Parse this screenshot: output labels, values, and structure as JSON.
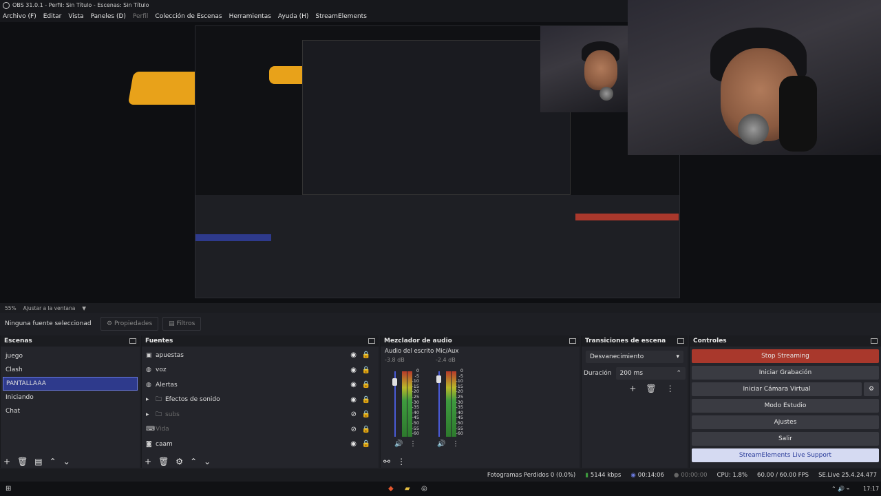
{
  "window": {
    "title": "OBS 31.0.1 - Perfil: Sin Título - Escenas: Sin Título"
  },
  "menu": [
    "Archivo (F)",
    "Editar",
    "Vista",
    "Paneles (D)",
    "Perfil",
    "Colección de Escenas",
    "Herramientas",
    "Ayuda (H)",
    "StreamElements"
  ],
  "preview_status": {
    "zoom": "55%",
    "fit": "Ajustar a la ventana"
  },
  "properties_bar": {
    "no_selection": "Ninguna fuente seleccionad",
    "properties": "Propiedades",
    "filters": "Filtros"
  },
  "scenes": {
    "title": "Escenas",
    "items": [
      "juego",
      "Clash",
      "PANTALLAAA",
      "Iniciando",
      "Chat"
    ],
    "selected": "PANTALLAAA"
  },
  "sources": {
    "title": "Fuentes",
    "items": [
      {
        "label": "apuestas",
        "icon": "monitor-icon",
        "visible": true
      },
      {
        "label": "voz",
        "icon": "globe-icon",
        "visible": true
      },
      {
        "label": "Alertas",
        "icon": "globe-icon",
        "visible": true
      },
      {
        "label": "Efectos de sonido",
        "icon": "folder-icon",
        "visible": true,
        "group": true
      },
      {
        "label": "subs",
        "icon": "folder-icon",
        "visible": false,
        "group": true
      },
      {
        "label": "Vida",
        "icon": "gamepad-icon",
        "visible": false
      },
      {
        "label": "caam",
        "icon": "camera-icon",
        "visible": true
      }
    ]
  },
  "mixer": {
    "title": "Mezclador de audio",
    "channels": [
      {
        "name": "Audio del escrito",
        "db": "-3.8 dB",
        "level": 0.75
      },
      {
        "name": "Mic/Aux",
        "db": "-2.4 dB",
        "level": 0.8
      }
    ],
    "scale": [
      "0",
      "-5",
      "-10",
      "-15",
      "-20",
      "-25",
      "-30",
      "-35",
      "-40",
      "-45",
      "-50",
      "-55",
      "-60"
    ]
  },
  "transitions": {
    "title": "Transiciones de escena",
    "selected": "Desvanecimiento",
    "duration_label": "Duración",
    "duration": "200 ms"
  },
  "controls": {
    "title": "Controles",
    "stop_streaming": "Stop Streaming",
    "start_recording": "Iniciar Grabación",
    "virtual_camera": "Iniciar Cámara Virtual",
    "studio_mode": "Modo Estudio",
    "settings": "Ajustes",
    "exit": "Salir",
    "support": "StreamElements Live Support"
  },
  "status": {
    "dropped": "Fotogramas Perdidos 0 (0.0%)",
    "bitrate": "5144 kbps",
    "stream_time": "00:14:06",
    "rec_time": "00:00:00",
    "cpu": "CPU: 1.8%",
    "fps": "60.00 / 60.00 FPS",
    "version": "SE.Live 25.4.24.477"
  },
  "taskbar": {
    "time": "17:17"
  },
  "colors": {
    "accent": "#2e3a8c",
    "stream_button": "#a9382c",
    "support_button": "#d5daf2",
    "logo": "#e8a21a"
  }
}
